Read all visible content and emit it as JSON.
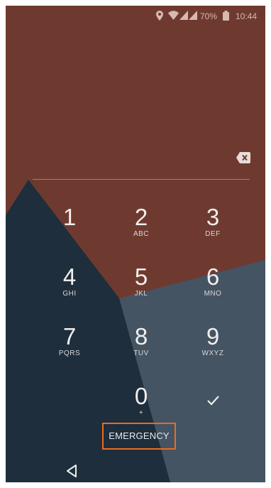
{
  "status_bar": {
    "location_icon": "location-pin-icon",
    "wifi_icon": "wifi-icon",
    "signal_icon": "cell-signal-icon",
    "battery_percent": "70%",
    "battery_icon": "battery-icon",
    "time": "10:44"
  },
  "pin_entry": {
    "backspace_icon": "backspace-icon"
  },
  "keypad": {
    "keys": [
      {
        "digit": "1",
        "letters": ""
      },
      {
        "digit": "2",
        "letters": "ABC"
      },
      {
        "digit": "3",
        "letters": "DEF"
      },
      {
        "digit": "4",
        "letters": "GHI"
      },
      {
        "digit": "5",
        "letters": "JKL"
      },
      {
        "digit": "6",
        "letters": "MNO"
      },
      {
        "digit": "7",
        "letters": "PQRS"
      },
      {
        "digit": "8",
        "letters": "TUV"
      },
      {
        "digit": "9",
        "letters": "WXYZ"
      },
      {
        "digit": "0",
        "letters": "+"
      }
    ],
    "enter_icon": "checkmark-icon"
  },
  "emergency_label": "EMERGENCY",
  "nav": {
    "back_icon": "back-triangle-icon"
  },
  "colors": {
    "wallpaper_top": "#6e3a30",
    "wallpaper_dark": "#1e2e3c",
    "wallpaper_gray": "#445463",
    "highlight": "#ee6a1e"
  }
}
